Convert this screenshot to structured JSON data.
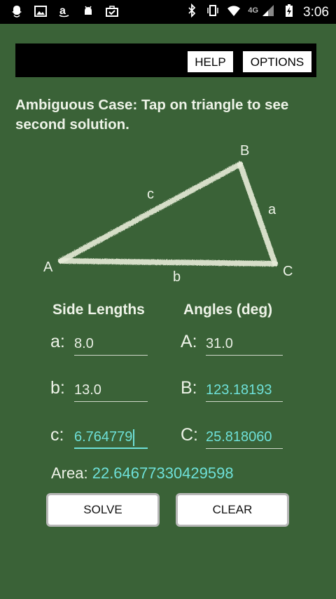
{
  "status_bar": {
    "left_icons": [
      "snapchat-icon",
      "image-icon",
      "amazon-icon",
      "android-debug-icon",
      "briefcase-check-icon"
    ],
    "right_icons": [
      "bluetooth-icon",
      "vibrate-icon",
      "wifi-icon",
      "cell-signal-icon",
      "battery-charging-icon"
    ],
    "network": "4G",
    "time": "3:06"
  },
  "toolbar": {
    "help_label": "HELP",
    "options_label": "OPTIONS"
  },
  "instruction": "Ambiguous Case: Tap on triangle to see second solution.",
  "triangle": {
    "vertex_a": "A",
    "vertex_b": "B",
    "vertex_c": "C",
    "side_a": "a",
    "side_b": "b",
    "side_c": "c",
    "chalk_color": "#e7ecd9"
  },
  "sides": {
    "heading": "Side Lengths",
    "a_label": "a:",
    "a_value": "8.0",
    "b_label": "b:",
    "b_value": "13.0",
    "c_label": "c:",
    "c_value": "6.764779"
  },
  "angles": {
    "heading": "Angles  (deg)",
    "A_label": "A:",
    "A_value": "31.0",
    "B_label": "B:",
    "B_value": "123.18193",
    "C_label": "C:",
    "C_value": "25.818060"
  },
  "area": {
    "label": "Area:",
    "value": "22.64677330429598"
  },
  "buttons": {
    "solve": "SOLVE",
    "clear": "CLEAR"
  },
  "colors": {
    "background": "#3a6237",
    "computed_value": "#6ee0d8",
    "text": "#eef3e8"
  }
}
